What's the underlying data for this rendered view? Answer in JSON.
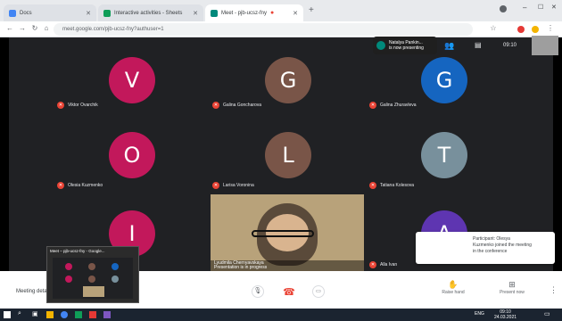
{
  "browser": {
    "tabs": [
      {
        "title": "Docs",
        "fav_color": "#4285f4"
      },
      {
        "title": "Interactive activities - Sheets",
        "fav_color": "#0f9d58"
      },
      {
        "title": "Meet - pjb-ucsz-fny",
        "fav_color": "#00897b"
      }
    ],
    "url": "meet.google.com/pjb-ucsz-fny?authuser=1"
  },
  "meet": {
    "participants": [
      {
        "initial": "V",
        "name": "Viktor Ovarchik",
        "color": "#c2185b"
      },
      {
        "initial": "G",
        "name": "Galina Goncharova",
        "color": "#795548"
      },
      {
        "initial": "G",
        "name": "Galina Zhuravleva",
        "color": "#1565c0"
      },
      {
        "initial": "O",
        "name": "Olesia Kuzmenko",
        "color": "#c2185b"
      },
      {
        "initial": "L",
        "name": "Larisa Voronina",
        "color": "#795548"
      },
      {
        "initial": "T",
        "name": "Tatiana Kolesova",
        "color": "#78909c"
      },
      {
        "initial": "I",
        "name": "",
        "color": "#c2185b"
      },
      {
        "initial": "A",
        "name": "Alla Ivan",
        "color": "#5e35b1"
      }
    ],
    "presenter": {
      "name": "Lyudmila Chernyavskaya",
      "sub": "Presentation is in progress"
    },
    "chip": {
      "line1": "Natalya Pankin...",
      "line2": "is now presenting"
    },
    "top_controls": {
      "time": "09:10"
    },
    "toast": {
      "line1": "Participant: Olesya",
      "line2": "Kuzmenko joined the meeting",
      "line3": "in the conference"
    },
    "preview_title": "Meet – pjb-ucsz-fny - Google...",
    "meeting_details_label": "Meeting details",
    "bottom": {
      "raise_hand": "Raise hand",
      "present": "Present now"
    }
  },
  "taskbar": {
    "time": "09:10",
    "date": "24.03.2021",
    "lang": "ENG"
  }
}
